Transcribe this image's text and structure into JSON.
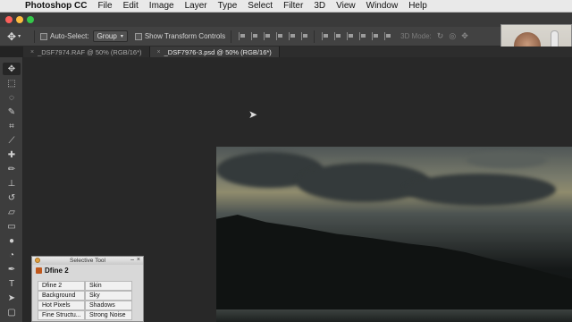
{
  "menubar": {
    "apple": "",
    "app_name": "Photoshop CC",
    "items": [
      "File",
      "Edit",
      "Image",
      "Layer",
      "Type",
      "Select",
      "Filter",
      "3D",
      "View",
      "Window",
      "Help"
    ]
  },
  "options_bar": {
    "auto_select_label": "Auto-Select:",
    "auto_select_value": "Group",
    "show_transform_label": "Show Transform Controls",
    "mode_3d_label": "3D Mode:"
  },
  "tabs": [
    {
      "label": "_DSF7974.RAF @ 50% (RGB/16*)",
      "active": false
    },
    {
      "label": "_DSF7976-3.psd @ 50% (RGB/16*)",
      "active": true
    }
  ],
  "tools": [
    "move-tool",
    "marquee-tool",
    "lasso-tool",
    "quick-select-tool",
    "crop-tool",
    "eyedropper-tool",
    "healing-brush-tool",
    "brush-tool",
    "clone-stamp-tool",
    "history-brush-tool",
    "eraser-tool",
    "gradient-tool",
    "blur-tool",
    "dodge-tool",
    "pen-tool",
    "type-tool",
    "path-select-tool",
    "shape-tool"
  ],
  "selective_tool": {
    "window_title": "Selective Tool",
    "heading": "Dfine 2",
    "rows": [
      [
        "Dfine 2",
        "Skin"
      ],
      [
        "Background",
        "Sky"
      ],
      [
        "Hot Pixels",
        "Shadows"
      ],
      [
        "Fine Structu...",
        "Strong Noise"
      ]
    ]
  },
  "colors": {
    "menubar_bg": "#e9e9e9",
    "app_bg": "#282828",
    "panel_bg": "#d8d8d8",
    "traffic_red": "#fc605b",
    "traffic_yellow": "#fdbc40",
    "traffic_green": "#34c84a"
  }
}
